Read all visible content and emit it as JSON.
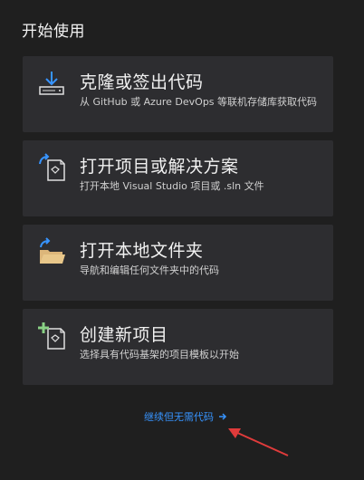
{
  "section_title": "开始使用",
  "cards": [
    {
      "title": "克隆或签出代码",
      "description": "从 GitHub 或 Azure DevOps 等联机存储库获取代码",
      "icon": "clone-download-icon"
    },
    {
      "title": "打开项目或解决方案",
      "description": "打开本地 Visual Studio 项目或 .sln 文件",
      "icon": "open-project-icon"
    },
    {
      "title": "打开本地文件夹",
      "description": "导航和编辑任何文件夹中的代码",
      "icon": "open-folder-icon"
    },
    {
      "title": "创建新项目",
      "description": "选择具有代码基架的项目模板以开始",
      "icon": "new-project-icon"
    }
  ],
  "continue_link": "继续但无需代码",
  "colors": {
    "background": "#1f1f1f",
    "card": "#2d2d30",
    "accent_blue": "#3794ff",
    "icon_folder": "#dcb67a",
    "icon_plus": "#89d185",
    "annotation_arrow": "#e03b3b"
  }
}
